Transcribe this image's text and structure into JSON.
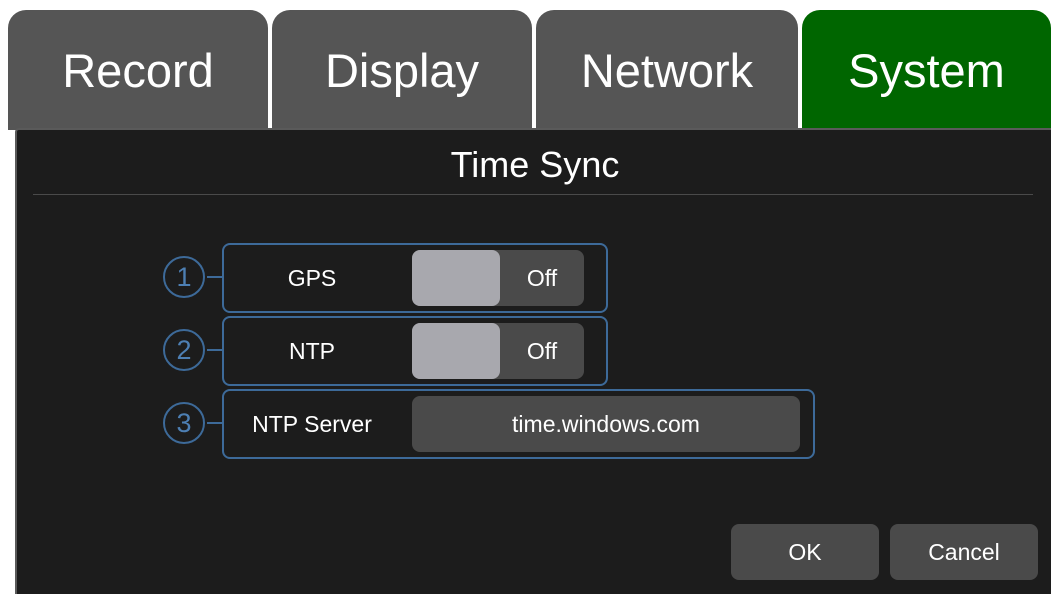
{
  "tabs": [
    {
      "label": "Record",
      "active": false
    },
    {
      "label": "Display",
      "active": false
    },
    {
      "label": "Network",
      "active": false
    },
    {
      "label": "System",
      "active": true
    }
  ],
  "dialog": {
    "title": "Time Sync",
    "settings": [
      {
        "number": "1",
        "label": "GPS",
        "type": "toggle",
        "state": "Off"
      },
      {
        "number": "2",
        "label": "NTP",
        "type": "toggle",
        "state": "Off"
      },
      {
        "number": "3",
        "label": "NTP Server",
        "type": "text",
        "value": "time.windows.com"
      }
    ],
    "ok_label": "OK",
    "cancel_label": "Cancel"
  },
  "colors": {
    "active_tab": "#006600",
    "inactive_tab": "#555555",
    "panel_bg": "#1c1c1c",
    "accent_border": "#3d6a99",
    "control_bg": "#4a4a4a",
    "toggle_knob": "#a8a8ae"
  }
}
